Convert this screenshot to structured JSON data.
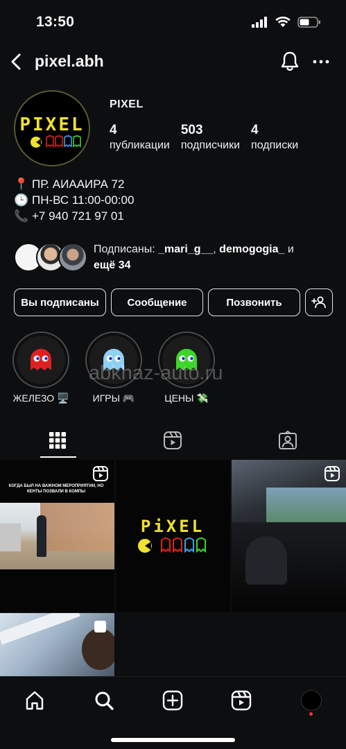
{
  "status_bar": {
    "time": "13:50"
  },
  "header": {
    "handle": "pixel.abh"
  },
  "profile": {
    "avatar_text": "PIXEL",
    "display_name": "PIXEL",
    "stats": [
      {
        "value": "4",
        "label": "публикации"
      },
      {
        "value": "503",
        "label": "подписчики"
      },
      {
        "value": "4",
        "label": "подписки"
      }
    ],
    "bio": [
      {
        "emoji": "📍",
        "text": "ПР. АИААИРА 72"
      },
      {
        "emoji": "🕒",
        "text": "ПН-ВС 11:00-00:00"
      },
      {
        "emoji": "📞",
        "text": "+7 940 721 97 01"
      }
    ]
  },
  "followed_by": {
    "prefix": "Подписаны: ",
    "user1": "_mari_g__",
    "separator": ", ",
    "user2": "demogogia_",
    "middle": " и",
    "more": "ещё 34"
  },
  "actions": {
    "following": "Вы подписаны",
    "message": "Сообщение",
    "call": "Позвонить"
  },
  "highlights": [
    {
      "label": "ЖЕЛЕЗО 🖥️",
      "color": "#e02020"
    },
    {
      "label": "ИГРЫ 🎮",
      "color": "#8fd0f5"
    },
    {
      "label": "ЦЕНЫ 💸",
      "color": "#3cd62a"
    }
  ],
  "watermark": "abkhaz-auto.ru",
  "posts": [
    {
      "caption": "КОГДА БЫЛ НА ВАЖНОМ МЕРОПРИЯТИИ, НО КЕНТЫ ПОЗВАЛИ В КОМПЫ",
      "type": "reel"
    },
    {
      "caption": "PiXEL",
      "type": "image"
    },
    {
      "caption": "",
      "type": "reel"
    },
    {
      "caption": "",
      "type": "carousel"
    }
  ],
  "colors": {
    "background": "#0c0e10",
    "accent_yellow": "#f0e030",
    "notification_dot": "#ff3040"
  }
}
